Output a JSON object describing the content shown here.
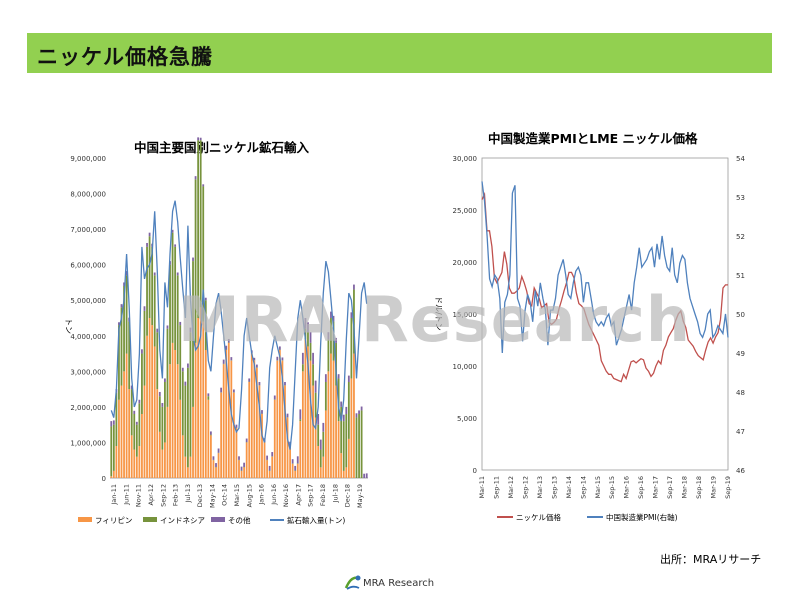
{
  "slide": {
    "title": "ニッケル価格急騰",
    "source": "出所：MRAリサーチ",
    "watermark": "MRA Research",
    "footer_logo": "MRA Research"
  },
  "chart_data": [
    {
      "type": "bar",
      "title": "中国主要国別ニッケル鉱石輸入",
      "ylabel": "トン",
      "ylim": [
        0,
        9000000
      ],
      "y_ticks": [
        "0",
        "1,000,000",
        "2,000,000",
        "3,000,000",
        "4,000,000",
        "5,000,000",
        "6,000,000",
        "7,000,000",
        "8,000,000",
        "9,000,000"
      ],
      "x_tick_labels": [
        "Jan-11",
        "Jun-11",
        "Nov-11",
        "Apr-12",
        "Sep-12",
        "Feb-13",
        "Jul-13",
        "Dec-13",
        "May-14",
        "Oct-14",
        "Mar-15",
        "Aug-15",
        "Jan-16",
        "Jun-16",
        "Nov-16",
        "Apr-17",
        "Sep-17",
        "Feb-18",
        "Jul-18",
        "Dec-18",
        "May-19"
      ],
      "series": [
        {
          "name": "フィリピン",
          "kind": "bar",
          "color": "#f79646",
          "values": [
            50000,
            200000,
            900000,
            2200000,
            2600000,
            3000000,
            3500000,
            2500000,
            1200000,
            800000,
            600000,
            900000,
            1800000,
            2600000,
            4000000,
            4500000,
            4300000,
            3700000,
            2500000,
            1300000,
            800000,
            1000000,
            2000000,
            3200000,
            3800000,
            3600000,
            3200000,
            2200000,
            1200000,
            600000,
            300000,
            600000,
            2000000,
            3800000,
            4500000,
            4800000,
            4400000,
            3600000,
            2200000,
            1200000,
            500000,
            300000,
            700000,
            2400000,
            3200000,
            3600000,
            3800000,
            3300000,
            2400000,
            1400000,
            500000,
            200000,
            300000,
            1000000,
            2700000,
            3500000,
            3300000,
            3100000,
            2600000,
            1800000,
            1000000,
            500000,
            200000,
            600000,
            2200000,
            3300000,
            3600000,
            3300000,
            2600000,
            1700000,
            900000,
            400000,
            200000,
            400000,
            1600000,
            3000000,
            3900000,
            3700000,
            3300000,
            2600000,
            1700000,
            900000,
            300000,
            600000,
            1900000,
            3000000,
            3500000,
            3300000,
            2600000,
            1600000,
            700000,
            200000,
            300000,
            1100000,
            2800000,
            3500000
          ]
        },
        {
          "name": "インドネシア",
          "kind": "bar",
          "color": "#77933c",
          "values": [
            1400000,
            1300000,
            1500000,
            2100000,
            2200000,
            2400000,
            2200000,
            1900000,
            1300000,
            1000000,
            900000,
            1200000,
            1700000,
            2100000,
            2500000,
            2300000,
            2200000,
            2000000,
            1600000,
            1000000,
            1200000,
            1700000,
            2200000,
            2800000,
            3100000,
            2900000,
            2500000,
            2100000,
            1800000,
            2000000,
            2800000,
            3500000,
            4100000,
            4600000,
            5000000,
            4700000,
            3800000,
            1400000,
            100000,
            20000,
            10000,
            10000,
            10000,
            10000,
            10000,
            10000,
            10000,
            10000,
            10000,
            10000,
            10000,
            10000,
            10000,
            10000,
            10000,
            10000,
            10000,
            10000,
            10000,
            10000,
            10000,
            10000,
            10000,
            10000,
            10000,
            10000,
            10000,
            10000,
            10000,
            10000,
            10000,
            10000,
            10000,
            10000,
            50000,
            200000,
            300000,
            400000,
            500000,
            600000,
            700000,
            600000,
            500000,
            700000,
            800000,
            900000,
            1000000,
            1100000,
            1200000,
            1200000,
            1300000,
            1400000,
            1500000,
            1600000,
            1700000,
            1800000,
            1700000,
            1800000,
            1900000
          ]
        },
        {
          "name": "その他",
          "kind": "bar",
          "color": "#8064a2",
          "values": [
            150000,
            120000,
            100000,
            80000,
            90000,
            100000,
            120000,
            110000,
            100000,
            90000,
            80000,
            100000,
            120000,
            130000,
            110000,
            100000,
            90000,
            80000,
            100000,
            120000,
            110000,
            100000,
            90000,
            100000,
            80000,
            70000,
            80000,
            90000,
            100000,
            110000,
            120000,
            130000,
            100000,
            90000,
            80000,
            70000,
            60000,
            70000,
            80000,
            90000,
            100000,
            110000,
            120000,
            130000,
            120000,
            110000,
            100000,
            90000,
            80000,
            90000,
            100000,
            110000,
            120000,
            100000,
            90000,
            80000,
            70000,
            80000,
            90000,
            100000,
            110000,
            120000,
            130000,
            120000,
            110000,
            100000,
            90000,
            80000,
            90000,
            100000,
            110000,
            120000,
            130000,
            200000,
            280000,
            320000,
            300000,
            280000,
            300000,
            320000,
            340000,
            300000,
            280000,
            250000,
            220000,
            200000,
            180000,
            160000,
            140000,
            120000,
            150000,
            180000,
            200000,
            180000,
            160000,
            140000,
            120000,
            100000,
            110000,
            120000,
            130000
          ]
        },
        {
          "name": "鉱石輸入量(トン)",
          "kind": "line",
          "color": "#4f81bd",
          "values": [
            1900000,
            1700000,
            2500000,
            4200000,
            4500000,
            5000000,
            6300000,
            4800000,
            2800000,
            2000000,
            2200000,
            3500000,
            6500000,
            5600000,
            5900000,
            6000000,
            6300000,
            7500000,
            5800000,
            3600000,
            2800000,
            5500000,
            4800000,
            6300000,
            7500000,
            7800000,
            7200000,
            6200000,
            5300000,
            4500000,
            7100000,
            5000000,
            4000000,
            3600000,
            3700000,
            4000000,
            5300000,
            4400000,
            3300000,
            3000000,
            4000000,
            4900000,
            5200000,
            4700000,
            4000000,
            3300000,
            2500000,
            1800000,
            1500000,
            1300000,
            1400000,
            2500000,
            4000000,
            4500000,
            4000000,
            3500000,
            3200000,
            2600000,
            2000000,
            1200000,
            1000000,
            1600000,
            3100000,
            3600000,
            4000000,
            3700000,
            3400000,
            2800000,
            1900000,
            1100000,
            800000,
            1500000,
            3000000,
            4500000,
            5000000,
            4500000,
            3900000,
            3200000,
            2200000,
            1500000,
            1400000,
            2000000,
            3800000,
            5200000,
            6100000,
            5800000,
            5000000,
            4200000,
            3000000,
            2000000,
            1600000,
            2200000,
            3900000,
            5200000,
            5000000,
            4200000,
            2800000,
            4000000,
            5200000,
            5500000,
            4900000
          ]
        }
      ],
      "legend": [
        "フィリピン",
        "インドネシア",
        "その他",
        "鉱石輸入量(トン)"
      ],
      "legend_position": "bottom"
    },
    {
      "type": "line",
      "title": "中国製造業PMIとLME ニッケル価格",
      "ylabel": "ドル/トン",
      "ylim": [
        0,
        30000
      ],
      "y_ticks": [
        "0",
        "5,000",
        "10,000",
        "15,000",
        "20,000",
        "25,000",
        "30,000"
      ],
      "y2lim": [
        46,
        54
      ],
      "y2_ticks": [
        "46",
        "47",
        "48",
        "49",
        "50",
        "51",
        "52",
        "53",
        "54"
      ],
      "x_tick_labels": [
        "Mar-11",
        "Sep-11",
        "Mar-12",
        "Sep-12",
        "Mar-13",
        "Sep-13",
        "Mar-14",
        "Sep-14",
        "Mar-15",
        "Sep-15",
        "Mar-16",
        "Sep-16",
        "Mar-17",
        "Sep-17",
        "Mar-18",
        "Sep-18",
        "Mar-19",
        "Sep-19"
      ],
      "series": [
        {
          "name": "ニッケル価格",
          "axis": "left",
          "color": "#c0504d",
          "values": [
            26000,
            26500,
            23000,
            23000,
            21500,
            18500,
            18000,
            18500,
            19000,
            21000,
            19800,
            17500,
            17000,
            17000,
            17200,
            17500,
            18600,
            18000,
            17200,
            16000,
            15800,
            17500,
            17000,
            16500,
            15600,
            15800,
            16000,
            14200,
            14000,
            14200,
            14500,
            15500,
            16300,
            17200,
            18000,
            19000,
            19000,
            18500,
            17000,
            16000,
            15800,
            15500,
            14700,
            14000,
            13500,
            13000,
            12500,
            12000,
            10500,
            10000,
            9500,
            9200,
            9200,
            8800,
            8700,
            8600,
            8500,
            9200,
            8800,
            9600,
            10400,
            10500,
            10300,
            10500,
            10700,
            10600,
            9800,
            9500,
            9000,
            9300,
            10000,
            10500,
            10200,
            11500,
            12000,
            12800,
            13200,
            13600,
            14400,
            15000,
            15300,
            14300,
            13700,
            12500,
            12200,
            11900,
            11400,
            11000,
            10800,
            10600,
            11500,
            12300,
            12700,
            12200,
            12800,
            13200,
            14500,
            17500,
            17800,
            17800
          ]
        },
        {
          "name": "中国製造業PMI(右軸)",
          "axis": "right",
          "color": "#4f81bd",
          "values": [
            53.4,
            52.9,
            52.0,
            50.9,
            50.7,
            51.0,
            50.9,
            50.4,
            49.0,
            50.3,
            50.5,
            51.0,
            53.1,
            53.3,
            50.4,
            50.2,
            49.3,
            50.1,
            50.5,
            50.3,
            49.8,
            50.6,
            50.2,
            50.8,
            50.4,
            50.1,
            49.2,
            50.1,
            50.1,
            50.4,
            51.0,
            51.2,
            51.4,
            51.0,
            50.5,
            50.4,
            50.8,
            51.1,
            51.2,
            51.0,
            50.3,
            50.8,
            50.8,
            50.4,
            50.0,
            49.8,
            49.7,
            49.8,
            49.7,
            49.9,
            50.0,
            49.7,
            49.8,
            49.2,
            49.4,
            49.6,
            49.9,
            50.2,
            50.5,
            50.1,
            50.8,
            51.2,
            51.7,
            51.2,
            51.3,
            51.4,
            51.6,
            51.7,
            51.2,
            51.8,
            51.4,
            52.0,
            51.5,
            51.2,
            51.1,
            51.7,
            51.0,
            50.8,
            51.3,
            51.5,
            51.4,
            50.8,
            50.4,
            50.2,
            50.0,
            49.8,
            49.5,
            49.4,
            49.6,
            50.0,
            50.1,
            49.4,
            49.5,
            49.7,
            49.6,
            49.5,
            50.0,
            49.4
          ]
        }
      ],
      "legend": [
        "ニッケル価格",
        "中国製造業PMI(右軸)"
      ],
      "legend_position": "bottom"
    }
  ]
}
